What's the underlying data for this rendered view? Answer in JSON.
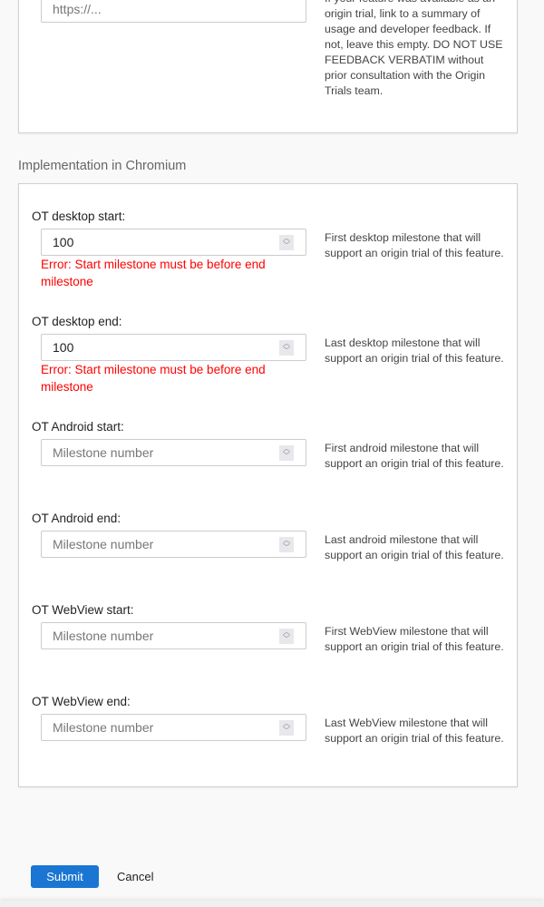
{
  "top_section": {
    "url_placeholder": "https://...",
    "help": "If your feature was available as an origin trial, link to a summary of usage and developer feedback. If not, leave this empty. DO NOT USE FEEDBACK VERBATIM without prior consultation with the Origin Trials team."
  },
  "section_title": "Implementation in Chromium",
  "fields": [
    {
      "label": "OT desktop start:",
      "value": "100",
      "placeholder": "Milestone number",
      "error_prefix": "Error",
      "error": ": Start milestone must be before end milestone",
      "help": "First desktop milestone that will support an origin trial of this feature."
    },
    {
      "label": "OT desktop end:",
      "value": "100",
      "placeholder": "Milestone number",
      "error_prefix": "Error",
      "error": ": Start milestone must be before end milestone",
      "help": "Last desktop milestone that will support an origin trial of this feature."
    },
    {
      "label": "OT Android start:",
      "value": "",
      "placeholder": "Milestone number",
      "help": "First android milestone that will support an origin trial of this feature."
    },
    {
      "label": "OT Android end:",
      "value": "",
      "placeholder": "Milestone number",
      "help": "Last android milestone that will support an origin trial of this feature."
    },
    {
      "label": "OT WebView start:",
      "value": "",
      "placeholder": "Milestone number",
      "help": "First WebView milestone that will support an origin trial of this feature."
    },
    {
      "label": "OT WebView end:",
      "value": "",
      "placeholder": "Milestone number",
      "help": "Last WebView milestone that will support an origin trial of this feature."
    }
  ],
  "actions": {
    "submit": "Submit",
    "cancel": "Cancel"
  },
  "colors": {
    "accent": "#1a76d2",
    "error": "#ff0000"
  }
}
